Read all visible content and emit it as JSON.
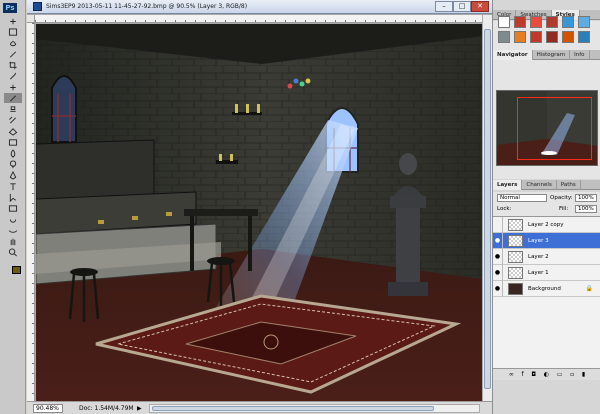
{
  "app": {
    "logo": "Ps"
  },
  "document": {
    "title": "Sims3EP9 2013-05-11 11-45-27-92.bmp @ 90.5% (Layer 3, RGB/8)",
    "zoom": "90.48%",
    "doc_size": "Doc: 1.54M/4.79M",
    "status_arrow": "▶",
    "window_buttons": {
      "minimize": "–",
      "maximize": "□",
      "close": "✕"
    }
  },
  "tools": [
    "move-tool",
    "marquee-tool",
    "lasso-tool",
    "quick-select-tool",
    "crop-tool",
    "eyedropper-tool",
    "healing-brush-tool",
    "brush-tool",
    "clone-stamp-tool",
    "history-brush-tool",
    "eraser-tool",
    "gradient-tool",
    "blur-tool",
    "dodge-tool",
    "pen-tool",
    "type-tool",
    "path-select-tool",
    "shape-tool",
    "3d-rotate-tool",
    "3d-orbit-tool",
    "hand-tool",
    "zoom-tool"
  ],
  "panels": {
    "top_tabs": [
      "Color",
      "Swatches",
      "Styles"
    ],
    "active_top_tab": "Styles",
    "style_colors": [
      "#ffffff",
      "#c0392b",
      "#e74c3c",
      "#b03a2e",
      "#3498db",
      "#5dade2",
      "#7f8c8d",
      "#e67e22",
      "#c0392b",
      "#922b21",
      "#d35400",
      "#2980b9",
      "#f0b27a",
      "#a04000",
      "#85929e",
      "#1a5276",
      "#cb4335",
      "#d4ac0d"
    ],
    "middle_tabs": [
      "Navigator",
      "Histogram",
      "Info"
    ],
    "active_middle_tab": "Navigator",
    "layer_tabs": [
      "Layers",
      "Channels",
      "Paths"
    ],
    "active_layer_tab": "Layers",
    "blend_mode": "Normal",
    "opacity_label": "Opacity:",
    "opacity_value": "100%",
    "lock_label": "Lock:",
    "fill_label": "Fill:",
    "fill_value": "100%",
    "layers": [
      {
        "name": "Layer 2 copy",
        "visible": false,
        "selected": false
      },
      {
        "name": "Layer 3",
        "visible": true,
        "selected": true
      },
      {
        "name": "Layer 2",
        "visible": true,
        "selected": false
      },
      {
        "name": "Layer 1",
        "visible": true,
        "selected": false
      },
      {
        "name": "Background",
        "visible": true,
        "selected": false,
        "locked": true
      }
    ],
    "layer_footer_icons": [
      "link-icon",
      "fx-icon",
      "mask-icon",
      "adjustment-icon",
      "folder-icon",
      "new-layer-icon",
      "trash-icon"
    ]
  }
}
